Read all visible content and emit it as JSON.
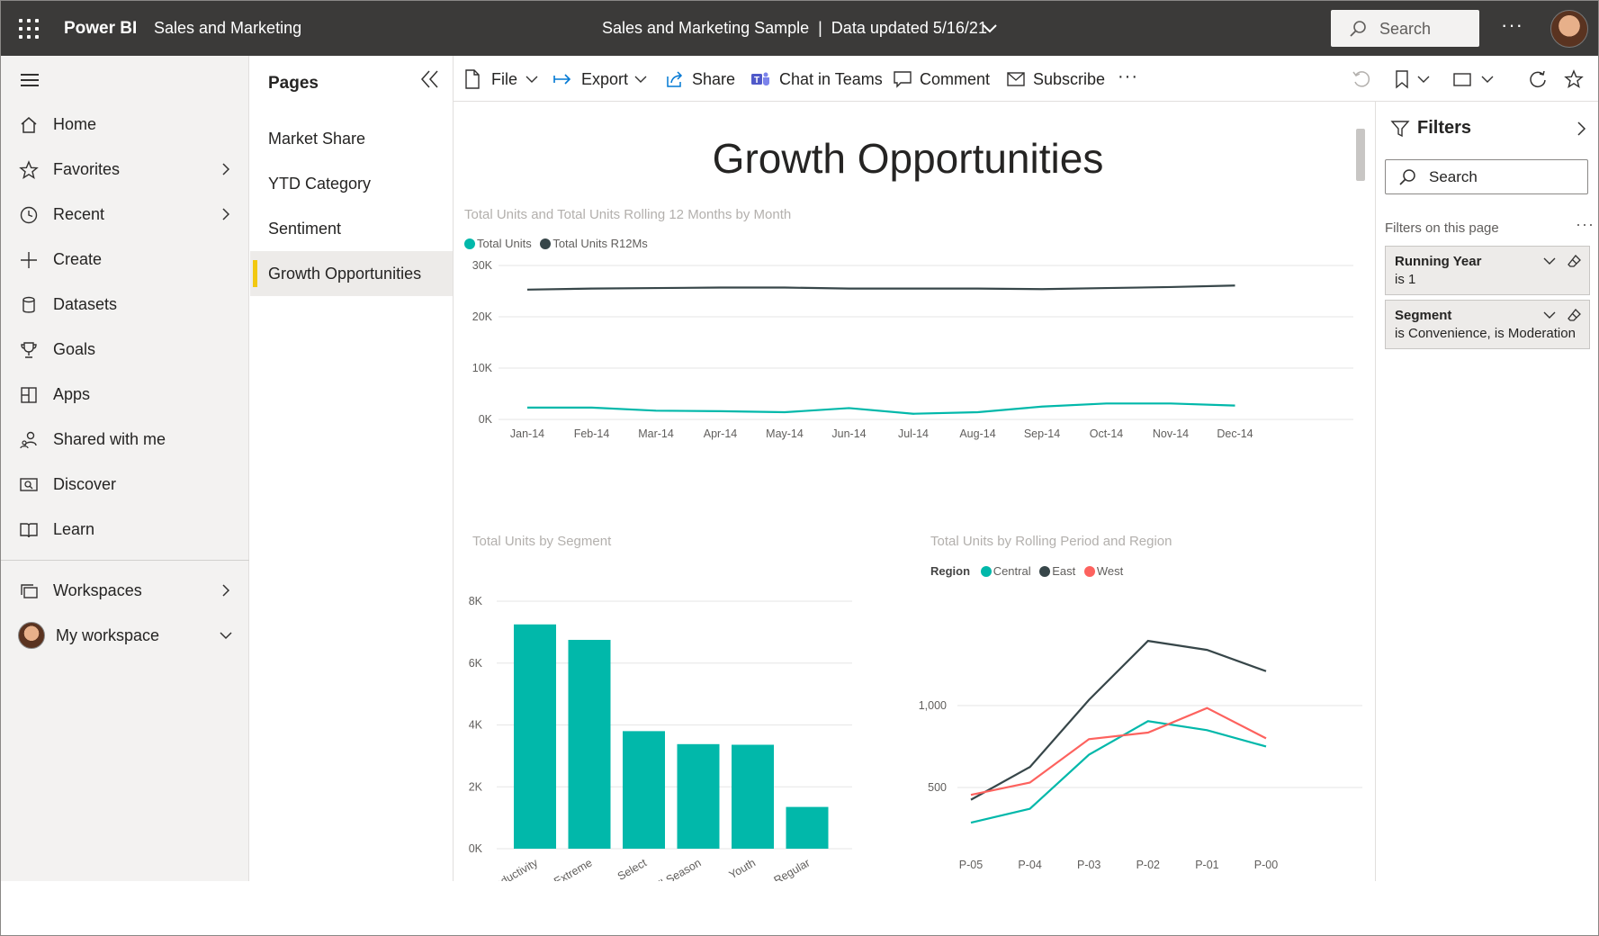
{
  "header": {
    "brand": "Power BI",
    "workspace": "Sales and Marketing",
    "report_title": "Sales and Marketing Sample  |  Data updated 5/16/21",
    "search_placeholder": "Search",
    "more": "···"
  },
  "nav": {
    "items": [
      {
        "label": "Home",
        "icon": "home-icon"
      },
      {
        "label": "Favorites",
        "icon": "star-icon"
      },
      {
        "label": "Recent",
        "icon": "clock-icon"
      },
      {
        "label": "Create",
        "icon": "plus-icon"
      },
      {
        "label": "Datasets",
        "icon": "database-icon"
      },
      {
        "label": "Goals",
        "icon": "trophy-icon"
      },
      {
        "label": "Apps",
        "icon": "apps-icon"
      },
      {
        "label": "Shared with me",
        "icon": "shared-icon"
      },
      {
        "label": "Discover",
        "icon": "discover-icon"
      },
      {
        "label": "Learn",
        "icon": "book-icon"
      }
    ],
    "workspaces": "Workspaces",
    "my_workspace": "My workspace"
  },
  "pages": {
    "title": "Pages",
    "items": [
      "Market Share",
      "YTD Category",
      "Sentiment",
      "Growth Opportunities"
    ],
    "active": "Growth Opportunities"
  },
  "toolbar": {
    "file": "File",
    "export": "Export",
    "share": "Share",
    "teams": "Chat in Teams",
    "comment": "Comment",
    "subscribe": "Subscribe",
    "more": "···"
  },
  "report": {
    "heading": "Growth Opportunities"
  },
  "colors": {
    "teal": "#01b8aa",
    "dark": "#374649",
    "red": "#fd625e",
    "accent": "#f2c811"
  },
  "chart_data": [
    {
      "type": "line",
      "title": "Total Units and Total Units Rolling 12 Months by Month",
      "categories": [
        "Jan-14",
        "Feb-14",
        "Mar-14",
        "Apr-14",
        "May-14",
        "Jun-14",
        "Jul-14",
        "Aug-14",
        "Sep-14",
        "Oct-14",
        "Nov-14",
        "Dec-14"
      ],
      "series": [
        {
          "name": "Total Units",
          "color": "#01b8aa",
          "values": [
            2300,
            2300,
            1700,
            1600,
            1400,
            2200,
            1100,
            1400,
            2500,
            3100,
            3100,
            2700
          ]
        },
        {
          "name": "Total Units R12Ms",
          "color": "#374649",
          "values": [
            25300,
            25500,
            25600,
            25700,
            25700,
            25500,
            25500,
            25500,
            25400,
            25600,
            25800,
            26100
          ]
        }
      ],
      "yticks": [
        "0K",
        "10K",
        "20K",
        "30K"
      ],
      "ylim": [
        0,
        30000
      ],
      "legend": "top-left",
      "grid": true
    },
    {
      "type": "bar",
      "title": "Total Units by Segment",
      "categories": [
        "Productivity",
        "Extreme",
        "Select",
        "All Season",
        "Youth",
        "Regular"
      ],
      "category_labels": [
        "roductivity",
        "Extreme",
        "Select",
        "ll Season",
        "Youth",
        "Regular"
      ],
      "values": [
        7250,
        6750,
        3800,
        3380,
        3360,
        1350
      ],
      "color": "#01b8aa",
      "yticks": [
        "0K",
        "2K",
        "4K",
        "6K",
        "8K"
      ],
      "ylim": [
        0,
        8000
      ],
      "grid": true
    },
    {
      "type": "line",
      "title": "Total Units by Rolling Period and Region",
      "legend_title": "Region",
      "categories": [
        "P-05",
        "P-04",
        "P-03",
        "P-02",
        "P-01",
        "P-00"
      ],
      "series": [
        {
          "name": "Central",
          "color": "#01b8aa",
          "values": [
            285,
            370,
            700,
            905,
            850,
            750
          ]
        },
        {
          "name": "East",
          "color": "#374649",
          "values": [
            425,
            625,
            1035,
            1395,
            1340,
            1210
          ]
        },
        {
          "name": "West",
          "color": "#fd625e",
          "values": [
            455,
            530,
            795,
            835,
            985,
            800
          ]
        }
      ],
      "yticks": [
        "500",
        "1,000"
      ],
      "ylim": [
        170,
        1500
      ],
      "legend": "top-left",
      "grid": true
    }
  ],
  "filters": {
    "title": "Filters",
    "search_placeholder": "Search",
    "section": "Filters on this page",
    "more": "···",
    "cards": [
      {
        "name": "Running Year",
        "value": "is 1"
      },
      {
        "name": "Segment",
        "value": "is Convenience, is Moderation"
      }
    ]
  }
}
